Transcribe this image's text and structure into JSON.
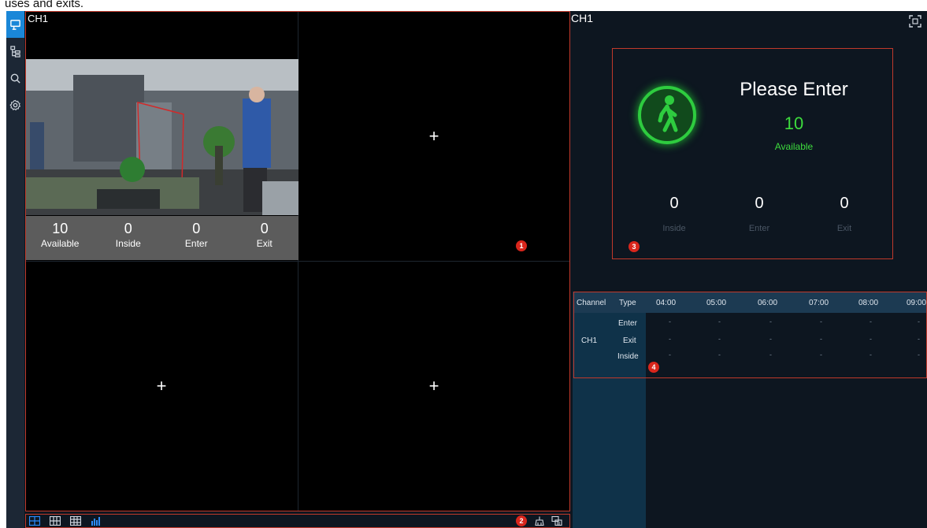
{
  "caption": "uses and exits.",
  "sidebar": {
    "items": [
      {
        "icon": "live-view-icon",
        "active": true
      },
      {
        "icon": "device-tree-icon",
        "active": false
      },
      {
        "icon": "search-icon",
        "active": false
      },
      {
        "icon": "settings-icon",
        "active": false
      }
    ]
  },
  "live": {
    "channel_label": "CH1",
    "counters": [
      {
        "value": "10",
        "label": "Available"
      },
      {
        "value": "0",
        "label": "Inside"
      },
      {
        "value": "0",
        "label": "Enter"
      },
      {
        "value": "0",
        "label": "Exit"
      }
    ],
    "empty_cell_symbol": "+"
  },
  "badges": {
    "one": "1",
    "two": "2",
    "three": "3",
    "four": "4"
  },
  "toolbar": {
    "left_icons": [
      "layout-1x1-icon",
      "layout-2x2-icon",
      "layout-3x3-icon",
      "people-count-icon"
    ],
    "right_icons": [
      "clear-icon",
      "export-icon"
    ]
  },
  "panel": {
    "title": "CH1",
    "fullscreen_icon": "fullscreen-icon",
    "status_message": "Please Enter",
    "available_value": "10",
    "available_label": "Available",
    "stats": [
      {
        "value": "0",
        "label": "Inside"
      },
      {
        "value": "0",
        "label": "Enter"
      },
      {
        "value": "0",
        "label": "Exit"
      }
    ]
  },
  "table": {
    "headers": [
      "Channel",
      "Type",
      "04:00",
      "05:00",
      "06:00",
      "07:00",
      "08:00",
      "09:00"
    ],
    "channel": "CH1",
    "rows": [
      {
        "type": "Enter",
        "values": [
          "-",
          "-",
          "-",
          "-",
          "-",
          "-"
        ]
      },
      {
        "type": "Exit",
        "values": [
          "-",
          "-",
          "-",
          "-",
          "-",
          "-"
        ]
      },
      {
        "type": "Inside",
        "values": [
          "-",
          "-",
          "-",
          "-",
          "-",
          "-"
        ]
      }
    ]
  },
  "colors": {
    "accent": "#1a87d8",
    "highlight": "#c0392b",
    "available": "#3ddc3d"
  }
}
